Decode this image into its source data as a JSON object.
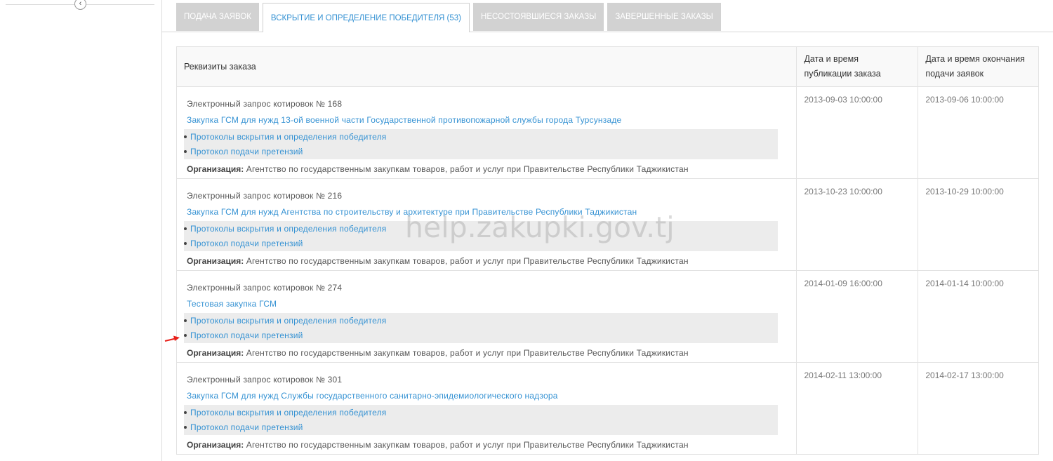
{
  "sidebar": {
    "collapse_icon": "chevron-left-icon",
    "collapse_glyph": "‹"
  },
  "tabs": [
    {
      "label": "ПОДАЧА ЗАЯВОК",
      "active": false
    },
    {
      "label": "ВСКРЫТИЕ И ОПРЕДЕЛЕНИЕ ПОБЕДИТЕЛЯ (53)",
      "active": true
    },
    {
      "label": "НЕСОСТОЯВШИЕСЯ ЗАКАЗЫ",
      "active": false
    },
    {
      "label": "ЗАВЕРШЕННЫЕ ЗАКАЗЫ",
      "active": false
    }
  ],
  "table": {
    "headers": {
      "details": "Реквизиты заказа",
      "published_line1": "Дата и время",
      "published_line2": "публикации заказа",
      "deadline_line1": "Дата и время окончания",
      "deadline_line2": "подачи заявок"
    },
    "rows": [
      {
        "type": "Электронный запрос котировок № 168",
        "title": "Закупка ГСМ для нужд 13-ой военной части Государственной противопожарной службы города Турсунзаде",
        "protocol1": "Протоколы вскрытия и определения победителя",
        "protocol2": "Протокол подачи претензий",
        "org_label": "Организация:",
        "org": "Агентство по государственным закупкам товаров, работ и услуг при Правительстве Республики Таджикистан",
        "published": "2013-09-03 10:00:00",
        "deadline": "2013-09-06 10:00:00"
      },
      {
        "type": "Электронный запрос котировок № 216",
        "title": "Закупка ГСМ для нужд Агентства по строительству и архитектуре при Правительстве Республики Таджикистан",
        "protocol1": "Протоколы вскрытия и определения победителя",
        "protocol2": "Протокол подачи претензий",
        "org_label": "Организация:",
        "org": "Агентство по государственным закупкам товаров, работ и услуг при Правительстве Республики Таджикистан",
        "published": "2013-10-23 10:00:00",
        "deadline": "2013-10-29 10:00:00"
      },
      {
        "type": "Электронный запрос котировок № 274",
        "title": "Тестовая закупка ГСМ",
        "protocol1": "Протоколы вскрытия и определения победителя",
        "protocol2": "Протокол подачи претензий",
        "org_label": "Организация:",
        "org": "Агентство по государственным закупкам товаров, работ и услуг при Правительстве Республики Таджикистан",
        "published": "2014-01-09 16:00:00",
        "deadline": "2014-01-14 10:00:00"
      },
      {
        "type": "Электронный запрос котировок № 301",
        "title": "Закупка ГСМ для нужд Службы государственного санитарно-эпидемиологического надзора",
        "protocol1": "Протоколы вскрытия и определения победителя",
        "protocol2": "Протокол подачи претензий",
        "org_label": "Организация:",
        "org": "Агентство по государственным закупкам товаров, работ и услуг при Правительстве Республики Таджикистан",
        "published": "2014-02-11 13:00:00",
        "deadline": "2014-02-17 13:00:00"
      }
    ]
  },
  "watermark": "help.zakupki.gov.tj",
  "colors": {
    "link": "#3592d3",
    "tab_inactive": "#d2d2d2",
    "arrow": "#e8201a",
    "protocol_bg": "#ececec"
  }
}
